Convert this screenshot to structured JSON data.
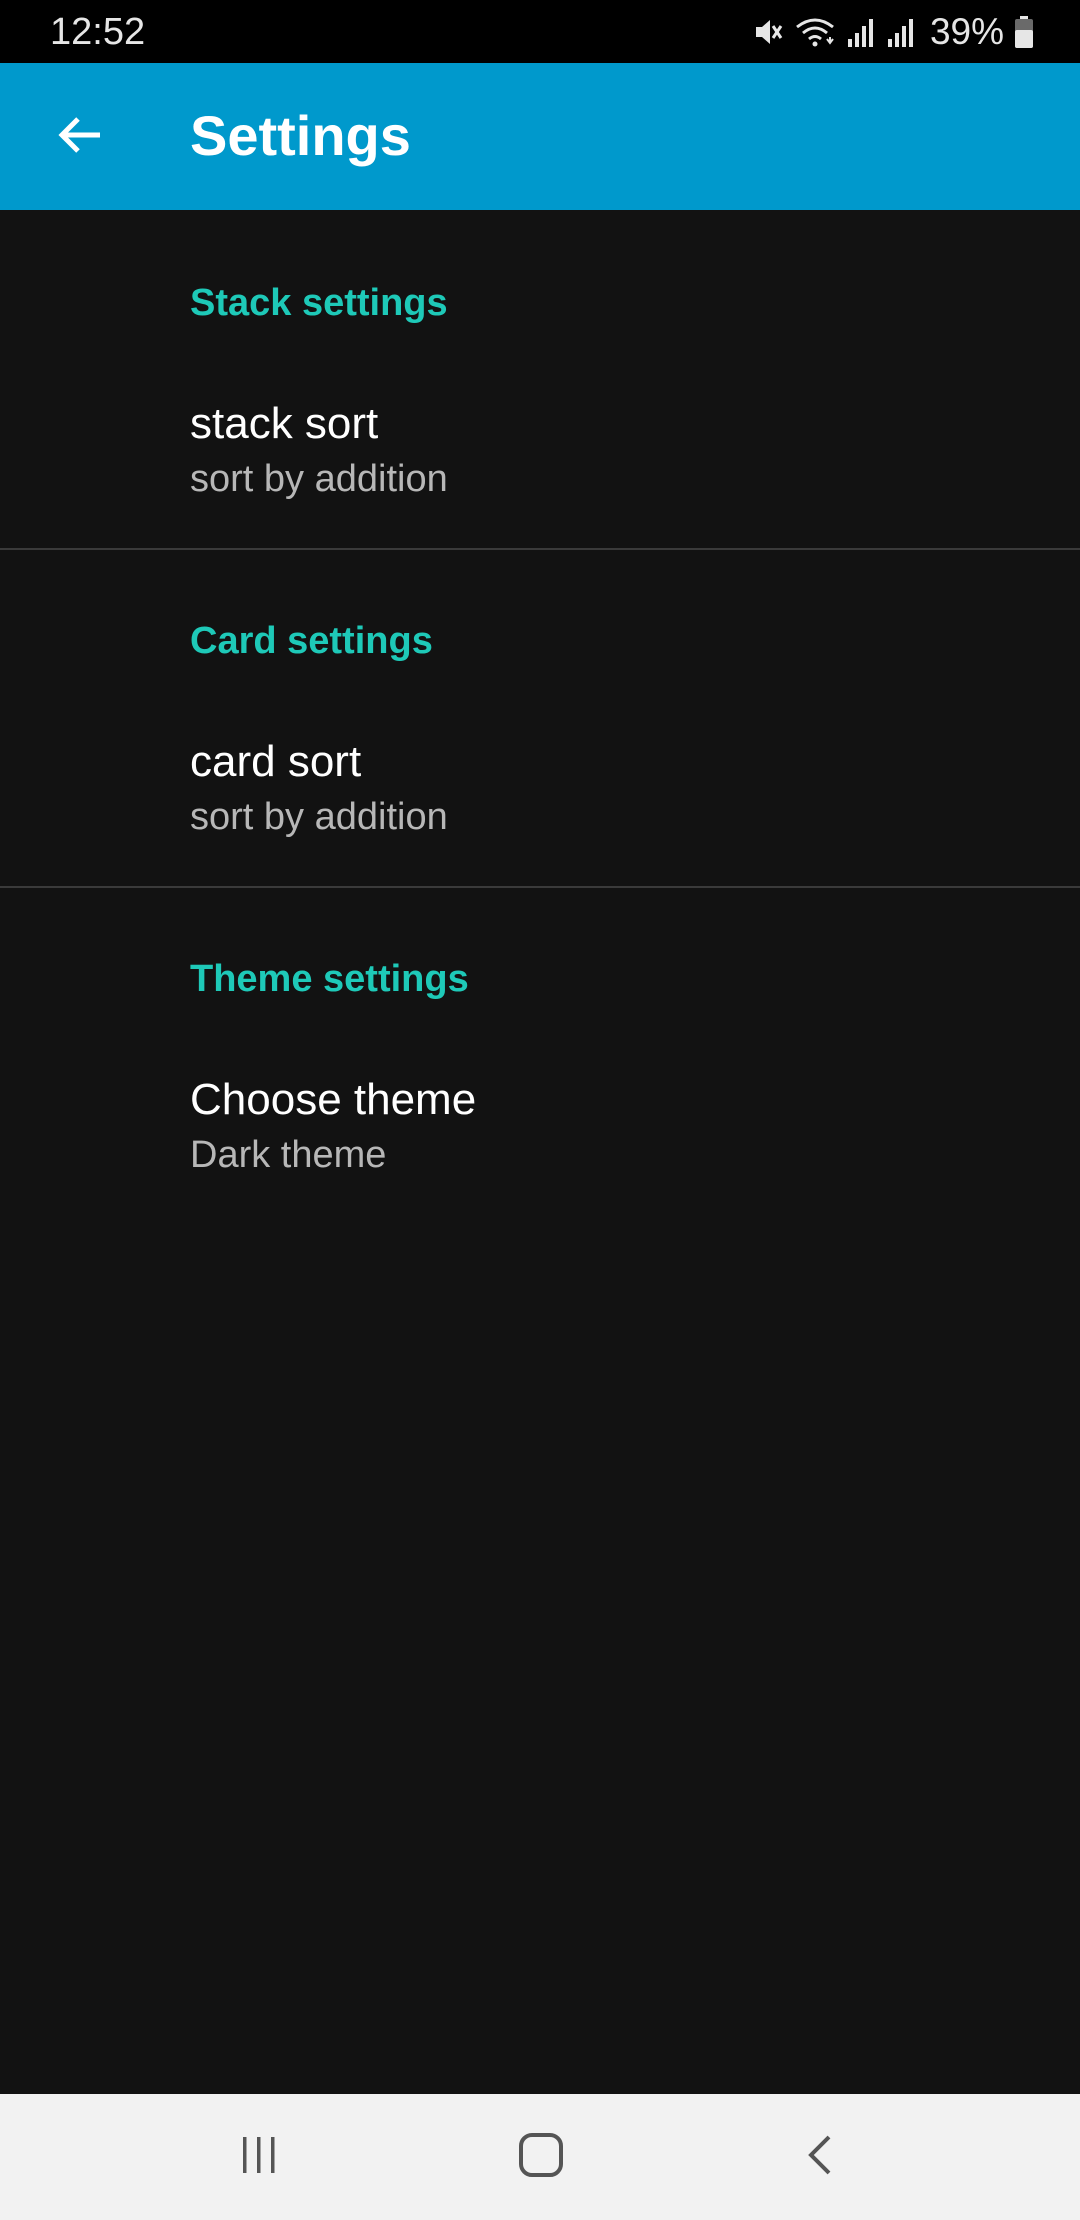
{
  "status_bar": {
    "time": "12:52",
    "battery_percent": "39%",
    "icons": [
      "mute-icon",
      "wifi-icon",
      "signal-icon",
      "signal-icon",
      "battery-icon"
    ]
  },
  "app_bar": {
    "title": "Settings",
    "back_icon": "arrow-left-icon",
    "color": "#0099cc"
  },
  "sections": [
    {
      "header": "Stack settings",
      "items": [
        {
          "title": "stack sort",
          "summary": "sort by addition"
        }
      ]
    },
    {
      "header": "Card settings",
      "items": [
        {
          "title": "card sort",
          "summary": "sort by addition"
        }
      ]
    },
    {
      "header": "Theme settings",
      "items": [
        {
          "title": "Choose theme",
          "summary": "Dark theme"
        }
      ]
    }
  ],
  "nav_bar": {
    "buttons": [
      "recents-icon",
      "home-icon",
      "back-icon"
    ]
  },
  "colors": {
    "accent": "#1ec9b8",
    "background": "#121212"
  }
}
